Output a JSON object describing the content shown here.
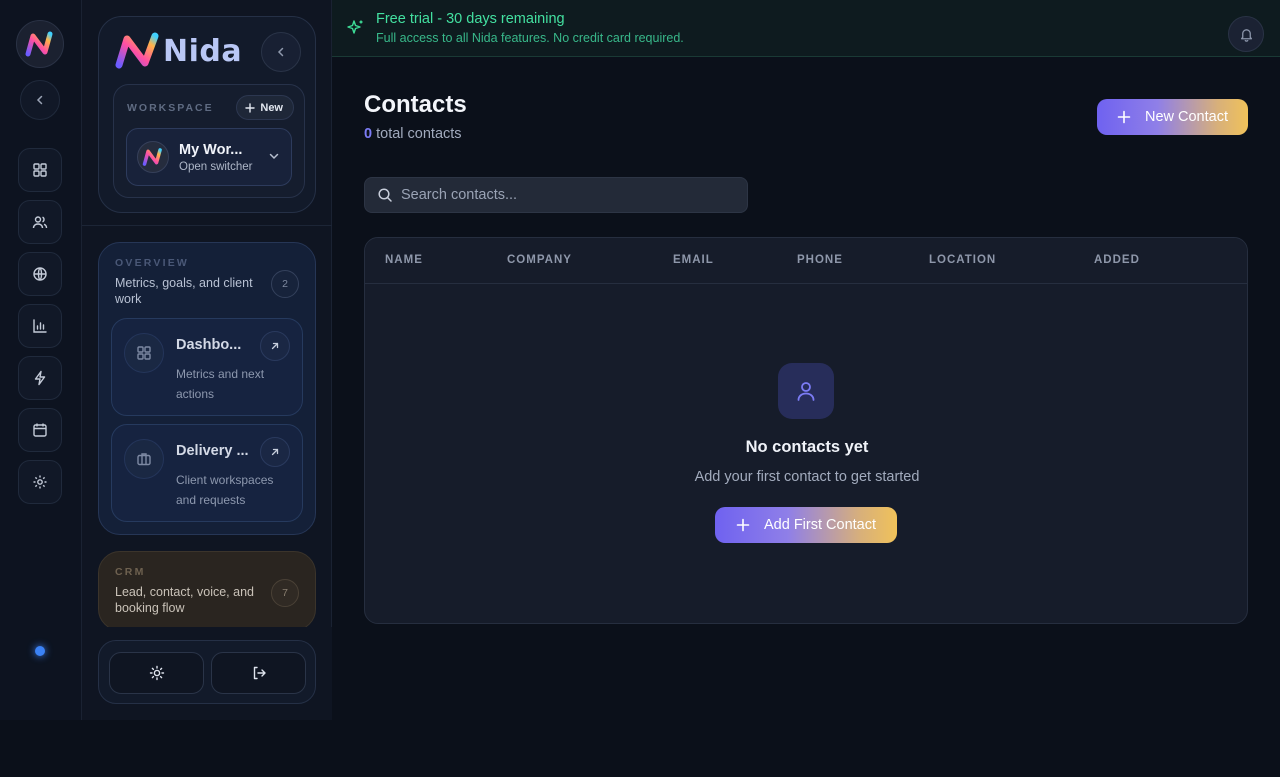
{
  "brand": {
    "name": "Nida"
  },
  "trial": {
    "title": "Free trial - 30 days remaining",
    "subtitle": "Full access to all Nida features. No credit card required."
  },
  "workspace": {
    "label": "WORKSPACE",
    "new_label": "New",
    "name": "My Wor...",
    "switcher_label": "Open switcher"
  },
  "rail": {
    "items": [
      {
        "icon": "dashboard-icon"
      },
      {
        "icon": "users-icon"
      },
      {
        "icon": "globe-icon"
      },
      {
        "icon": "bar-chart-icon"
      },
      {
        "icon": "bolt-icon"
      },
      {
        "icon": "calendar-icon"
      },
      {
        "icon": "gear-icon"
      }
    ]
  },
  "groups": {
    "overview": {
      "label": "OVERVIEW",
      "description": "Metrics, goals, and client work",
      "count": "2",
      "items": [
        {
          "title": "Dashbo...",
          "description": "Metrics and next actions"
        },
        {
          "title": "Delivery ...",
          "description": "Client workspaces and requests"
        }
      ]
    },
    "crm": {
      "label": "CRM",
      "description": "Lead, contact, voice, and booking flow",
      "count": "7"
    }
  },
  "page": {
    "title": "Contacts",
    "count": "0",
    "count_suffix": "total contacts",
    "new_button": "New Contact"
  },
  "search": {
    "placeholder": "Search contacts..."
  },
  "table": {
    "columns": [
      "NAME",
      "COMPANY",
      "EMAIL",
      "PHONE",
      "LOCATION",
      "ADDED"
    ]
  },
  "empty": {
    "title": "No contacts yet",
    "subtitle": "Add your first contact to get started",
    "button": "Add First Contact"
  },
  "colors": {
    "accent": "#7c7cf5",
    "trial_green": "#43e0a0",
    "overview_label": "#4a5877",
    "crm_label": "#6e6150"
  }
}
